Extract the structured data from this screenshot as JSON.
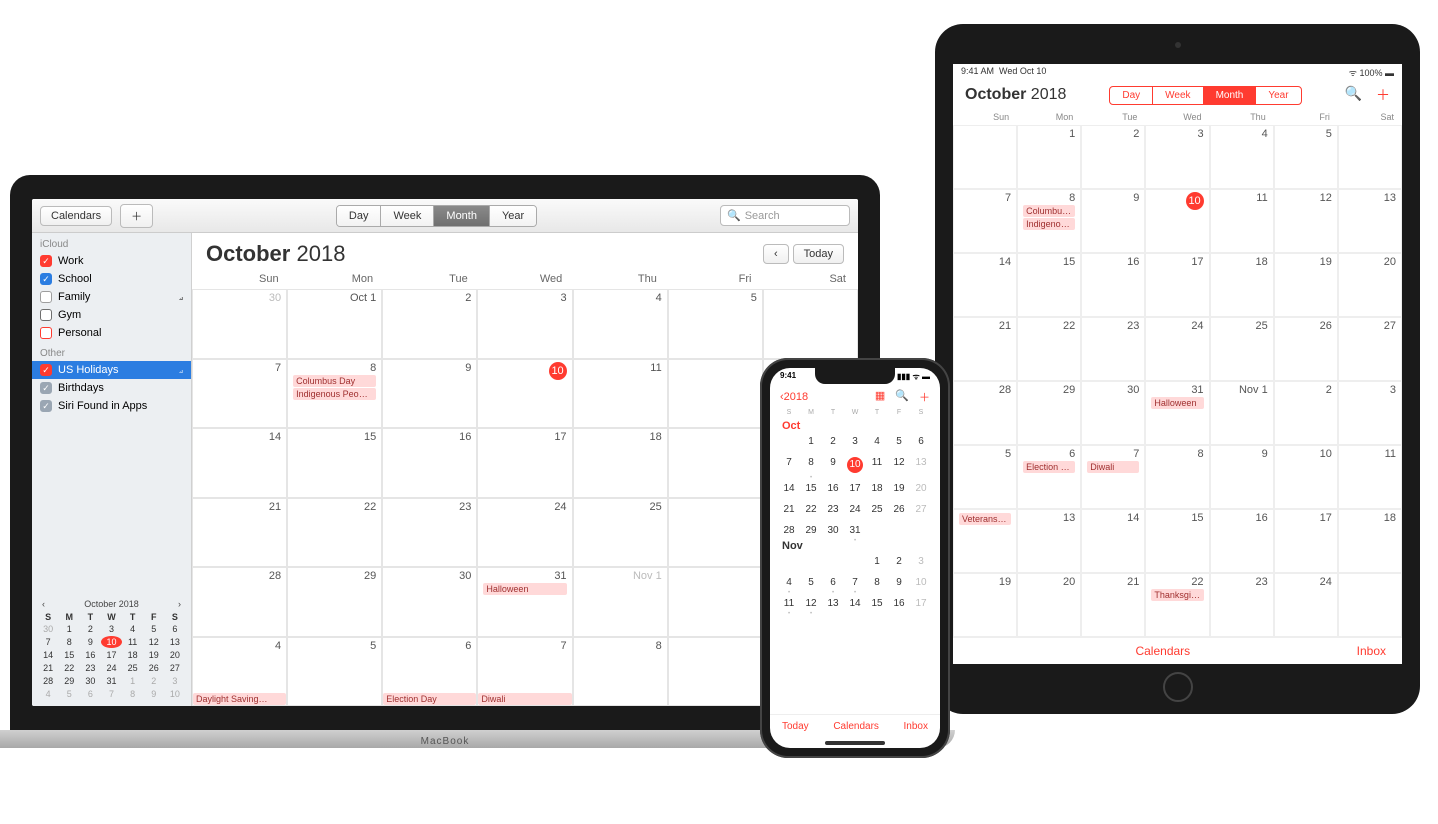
{
  "mac": {
    "toolbar": {
      "calendars": "Calendars",
      "view": [
        "Day",
        "Week",
        "Month",
        "Year"
      ],
      "active_view": 2,
      "search_ph": "Search",
      "today": "Today",
      "brand": "MacBook"
    },
    "title_month": "October",
    "title_year": "2018",
    "sidebar": {
      "groups": [
        {
          "name": "iCloud",
          "items": [
            {
              "label": "Work",
              "color": "#ff3b30",
              "checked": true
            },
            {
              "label": "School",
              "color": "#2b7de1",
              "checked": true
            },
            {
              "label": "Family",
              "color": "#9e9e9e",
              "checked": false,
              "rss": true
            },
            {
              "label": "Gym",
              "color": "#6e6e6e",
              "checked": false
            },
            {
              "label": "Personal",
              "color": "#ff3b30",
              "checked": false
            }
          ]
        },
        {
          "name": "Other",
          "items": [
            {
              "label": "US Holidays",
              "color": "#ff3b30",
              "checked": true,
              "selected": true,
              "rss": true
            },
            {
              "label": "Birthdays",
              "color": "#9aa6b3",
              "checked": true
            },
            {
              "label": "Siri Found in Apps",
              "color": "#9aa6b3",
              "checked": true
            }
          ]
        }
      ]
    },
    "dow": [
      "Sun",
      "Mon",
      "Tue",
      "Wed",
      "Thu",
      "Fri",
      "Sat"
    ],
    "cells": [
      {
        "n": "30",
        "dim": true
      },
      {
        "n": "Oct 1"
      },
      {
        "n": "2"
      },
      {
        "n": "3"
      },
      {
        "n": "4"
      },
      {
        "n": "5"
      },
      {
        "n": ""
      },
      {
        "n": "7"
      },
      {
        "n": "8",
        "ev": [
          "Columbus Day",
          "Indigenous Peo…"
        ]
      },
      {
        "n": "9"
      },
      {
        "n": "10",
        "today": true
      },
      {
        "n": "11"
      },
      {
        "n": ""
      },
      {
        "n": ""
      },
      {
        "n": "14"
      },
      {
        "n": "15"
      },
      {
        "n": "16"
      },
      {
        "n": "17"
      },
      {
        "n": "18"
      },
      {
        "n": ""
      },
      {
        "n": ""
      },
      {
        "n": "21"
      },
      {
        "n": "22"
      },
      {
        "n": "23"
      },
      {
        "n": "24"
      },
      {
        "n": "25"
      },
      {
        "n": ""
      },
      {
        "n": ""
      },
      {
        "n": "28"
      },
      {
        "n": "29"
      },
      {
        "n": "30"
      },
      {
        "n": "31",
        "ev": [
          "Halloween"
        ]
      },
      {
        "n": "Nov 1",
        "dim": true
      },
      {
        "n": ""
      },
      {
        "n": ""
      },
      {
        "n": "4",
        "ev_cut": [
          "Daylight Saving…"
        ]
      },
      {
        "n": "5"
      },
      {
        "n": "6",
        "ev_cut": [
          "Election Day"
        ]
      },
      {
        "n": "7",
        "ev_cut": [
          "Diwali"
        ]
      },
      {
        "n": "8"
      },
      {
        "n": ""
      },
      {
        "n": ""
      }
    ],
    "mini": {
      "title": "October 2018",
      "dow": [
        "S",
        "M",
        "T",
        "W",
        "T",
        "F",
        "S"
      ],
      "days": [
        {
          "n": "30",
          "dim": true
        },
        {
          "n": "1"
        },
        {
          "n": "2"
        },
        {
          "n": "3"
        },
        {
          "n": "4"
        },
        {
          "n": "5"
        },
        {
          "n": "6"
        },
        {
          "n": "7"
        },
        {
          "n": "8"
        },
        {
          "n": "9"
        },
        {
          "n": "10",
          "today": true
        },
        {
          "n": "11"
        },
        {
          "n": "12"
        },
        {
          "n": "13"
        },
        {
          "n": "14"
        },
        {
          "n": "15"
        },
        {
          "n": "16"
        },
        {
          "n": "17"
        },
        {
          "n": "18"
        },
        {
          "n": "19"
        },
        {
          "n": "20"
        },
        {
          "n": "21"
        },
        {
          "n": "22"
        },
        {
          "n": "23"
        },
        {
          "n": "24"
        },
        {
          "n": "25"
        },
        {
          "n": "26"
        },
        {
          "n": "27"
        },
        {
          "n": "28"
        },
        {
          "n": "29"
        },
        {
          "n": "30"
        },
        {
          "n": "31"
        },
        {
          "n": "1",
          "dim": true
        },
        {
          "n": "2",
          "dim": true
        },
        {
          "n": "3",
          "dim": true
        },
        {
          "n": "4",
          "dim": true
        },
        {
          "n": "5",
          "dim": true
        },
        {
          "n": "6",
          "dim": true
        },
        {
          "n": "7",
          "dim": true
        },
        {
          "n": "8",
          "dim": true
        },
        {
          "n": "9",
          "dim": true
        },
        {
          "n": "10",
          "dim": true
        }
      ]
    }
  },
  "ipad": {
    "status": {
      "time": "9:41 AM",
      "date": "Wed Oct 10",
      "batt": "100%"
    },
    "title_month": "October",
    "title_year": "2018",
    "view": [
      "Day",
      "Week",
      "Month",
      "Year"
    ],
    "active_view": 2,
    "dow": [
      "Sun",
      "Mon",
      "Tue",
      "Wed",
      "Thu",
      "Fri",
      "Sat"
    ],
    "cells": [
      {
        "n": ""
      },
      {
        "n": "1"
      },
      {
        "n": "2"
      },
      {
        "n": "3"
      },
      {
        "n": "4"
      },
      {
        "n": "5"
      },
      {
        "n": ""
      },
      {
        "n": "7"
      },
      {
        "n": "8",
        "ev": [
          "Columbus Day",
          "Indigenous Peop…"
        ]
      },
      {
        "n": "9"
      },
      {
        "n": "10",
        "today": true
      },
      {
        "n": "11"
      },
      {
        "n": "12"
      },
      {
        "n": "13"
      },
      {
        "n": "14"
      },
      {
        "n": "15"
      },
      {
        "n": "16"
      },
      {
        "n": "17"
      },
      {
        "n": "18"
      },
      {
        "n": "19"
      },
      {
        "n": "20"
      },
      {
        "n": "21"
      },
      {
        "n": "22"
      },
      {
        "n": "23"
      },
      {
        "n": "24"
      },
      {
        "n": "25"
      },
      {
        "n": "26"
      },
      {
        "n": "27"
      },
      {
        "n": "28"
      },
      {
        "n": "29"
      },
      {
        "n": "30"
      },
      {
        "n": "31",
        "ev": [
          "Halloween"
        ]
      },
      {
        "n": "Nov 1"
      },
      {
        "n": "2"
      },
      {
        "n": "3"
      },
      {
        "n": "5"
      },
      {
        "n": "6",
        "ev": [
          "Election Day"
        ]
      },
      {
        "n": "7",
        "ev": [
          "Diwali"
        ]
      },
      {
        "n": "8"
      },
      {
        "n": "9"
      },
      {
        "n": "10"
      },
      {
        "n": "11"
      },
      {
        "n": "",
        "ev": [
          "Veterans Day (o…"
        ]
      },
      {
        "n": "13"
      },
      {
        "n": "14"
      },
      {
        "n": "15"
      },
      {
        "n": "16"
      },
      {
        "n": "17"
      },
      {
        "n": "18"
      },
      {
        "n": "19"
      },
      {
        "n": "20"
      },
      {
        "n": "21"
      },
      {
        "n": "22",
        "ev": [
          "Thanksgiving"
        ]
      },
      {
        "n": "23"
      },
      {
        "n": "24"
      },
      {
        "n": ""
      }
    ],
    "foot": {
      "cal": "Calendars",
      "inbox": "Inbox"
    }
  },
  "iphone": {
    "status_time": "9:41",
    "back": "2018",
    "dow": [
      "S",
      "M",
      "T",
      "W",
      "T",
      "F",
      "S"
    ],
    "oct_label": "Oct",
    "nov_label": "Nov",
    "oct": [
      {
        "n": ""
      },
      {
        "n": "1"
      },
      {
        "n": "2"
      },
      {
        "n": "3"
      },
      {
        "n": "4"
      },
      {
        "n": "5"
      },
      {
        "n": "6"
      },
      {
        "n": "7"
      },
      {
        "n": "8",
        "dot": true
      },
      {
        "n": "9"
      },
      {
        "n": "10",
        "today": true
      },
      {
        "n": "11"
      },
      {
        "n": "12"
      },
      {
        "n": "13",
        "dim": true
      },
      {
        "n": "14"
      },
      {
        "n": "15"
      },
      {
        "n": "16"
      },
      {
        "n": "17"
      },
      {
        "n": "18"
      },
      {
        "n": "19"
      },
      {
        "n": "20",
        "dim": true
      },
      {
        "n": "21"
      },
      {
        "n": "22"
      },
      {
        "n": "23"
      },
      {
        "n": "24"
      },
      {
        "n": "25"
      },
      {
        "n": "26"
      },
      {
        "n": "27",
        "dim": true
      },
      {
        "n": "28"
      },
      {
        "n": "29"
      },
      {
        "n": "30"
      },
      {
        "n": "31",
        "dot": true
      },
      {
        "n": ""
      },
      {
        "n": ""
      },
      {
        "n": ""
      }
    ],
    "nov": [
      {
        "n": ""
      },
      {
        "n": ""
      },
      {
        "n": ""
      },
      {
        "n": ""
      },
      {
        "n": "1"
      },
      {
        "n": "2"
      },
      {
        "n": "3",
        "dim": true
      },
      {
        "n": "4",
        "dot": true
      },
      {
        "n": "5"
      },
      {
        "n": "6",
        "dot": true
      },
      {
        "n": "7",
        "dot": true
      },
      {
        "n": "8"
      },
      {
        "n": "9"
      },
      {
        "n": "10",
        "dim": true
      },
      {
        "n": "11",
        "dot": true
      },
      {
        "n": "12",
        "dot": true
      },
      {
        "n": "13"
      },
      {
        "n": "14"
      },
      {
        "n": "15"
      },
      {
        "n": "16"
      },
      {
        "n": "17",
        "dim": true
      }
    ],
    "foot": {
      "today": "Today",
      "cal": "Calendars",
      "inbox": "Inbox"
    }
  }
}
